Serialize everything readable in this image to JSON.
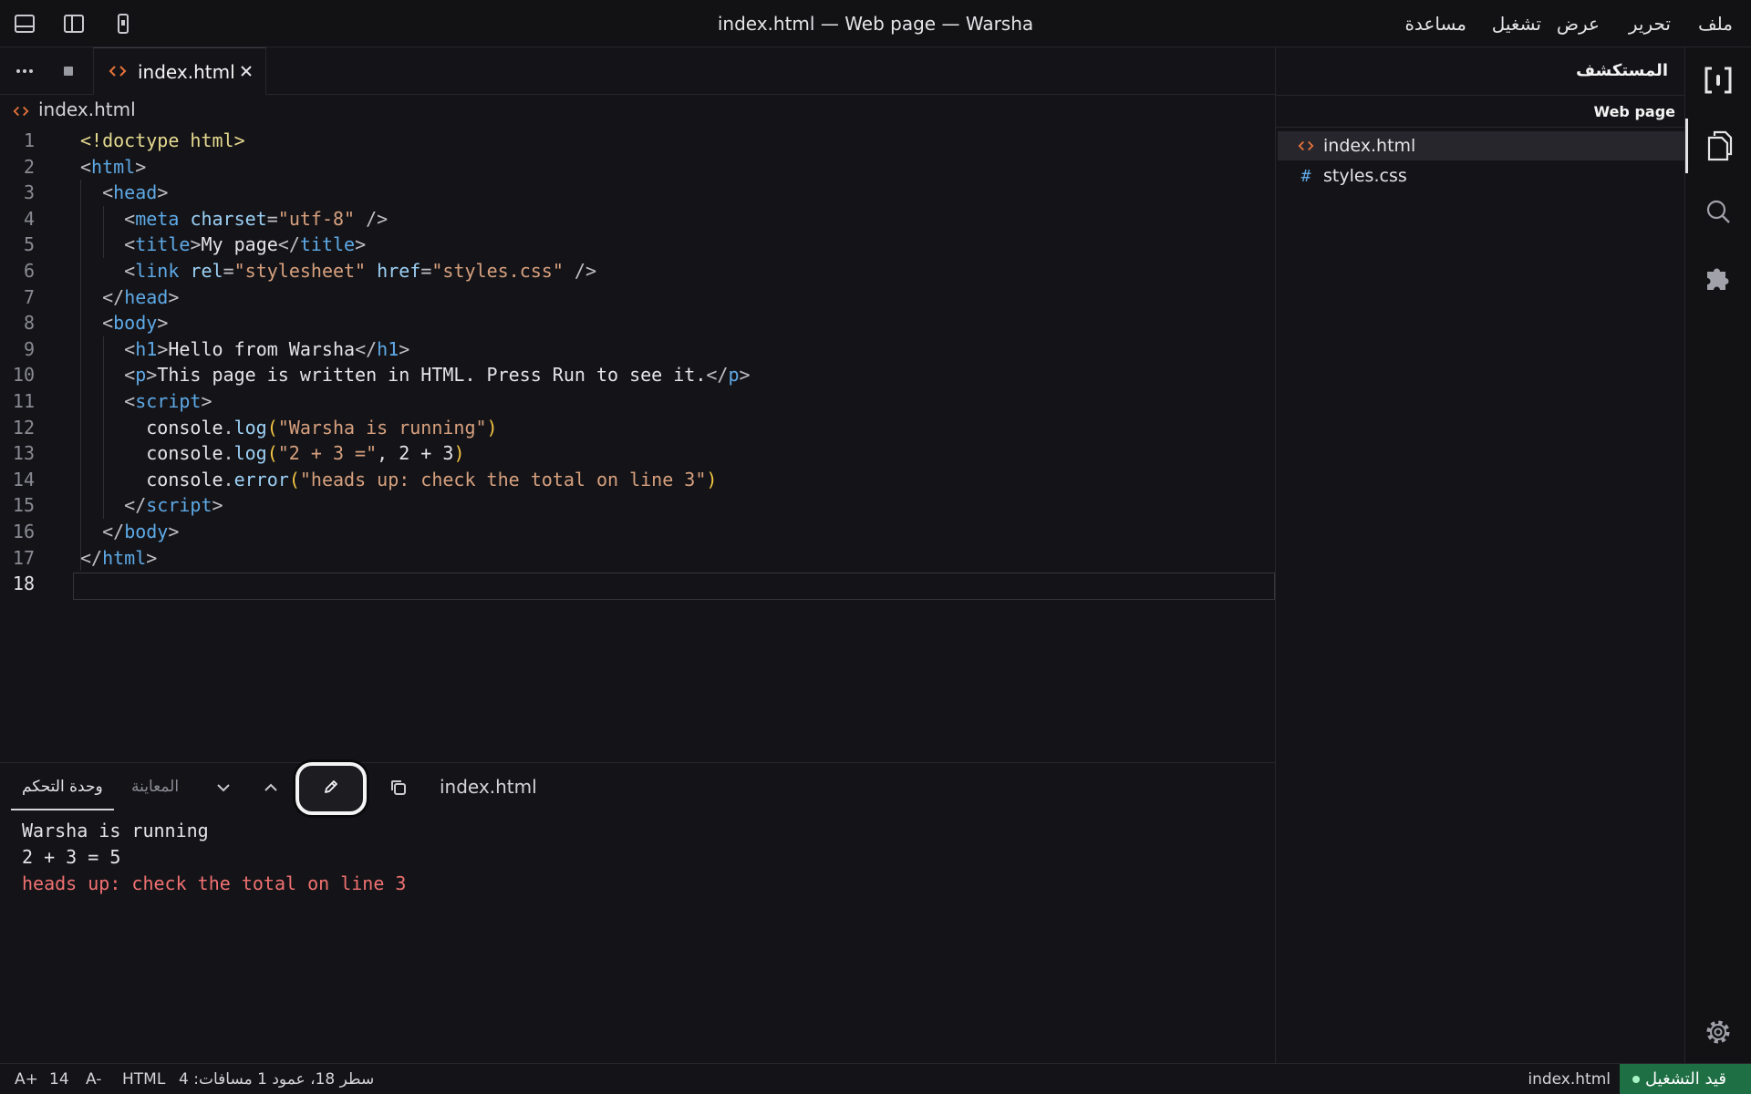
{
  "window": {
    "title": "index.html — Web page — Warsha"
  },
  "menu": [
    {
      "label": "ملف"
    },
    {
      "label": "تحرير"
    },
    {
      "label": "عرض"
    },
    {
      "label": "تشغيل"
    },
    {
      "label": "مساعدة"
    }
  ],
  "editor": {
    "tab_label": "index.html",
    "breadcrumb": "index.html",
    "active_line": 18,
    "lines": [
      {
        "n": "1"
      },
      {
        "n": "2"
      },
      {
        "n": "3"
      },
      {
        "n": "4"
      },
      {
        "n": "5"
      },
      {
        "n": "6"
      },
      {
        "n": "7"
      },
      {
        "n": "8"
      },
      {
        "n": "9"
      },
      {
        "n": "10"
      },
      {
        "n": "11"
      },
      {
        "n": "12"
      },
      {
        "n": "13"
      },
      {
        "n": "14"
      },
      {
        "n": "15"
      },
      {
        "n": "16"
      },
      {
        "n": "17"
      },
      {
        "n": "18"
      }
    ],
    "code": {
      "l1_doctype": "<!doctype html>",
      "l2_tag": "html",
      "l3_tag": "head",
      "l4_tag": "meta",
      "l4_attr": "charset",
      "l4_val": "\"utf-8\"",
      "l5_tag": "title",
      "l5_text": "My page",
      "l6_tag": "link",
      "l6_attr1": "rel",
      "l6_val1": "\"stylesheet\"",
      "l6_attr2": "href",
      "l6_val2": "\"styles.css\"",
      "l7_tag": "head",
      "l8_tag": "body",
      "l9_tag": "h1",
      "l9_text": "Hello from Warsha",
      "l10_tag": "p",
      "l10_text": "This page is written in HTML. Press Run to see it.",
      "l11_tag": "script",
      "l12_obj": "console",
      "l12_fn": "log",
      "l12_str": "\"Warsha is running\"",
      "l13_obj": "console",
      "l13_fn": "log",
      "l13_str": "\"2 + 3 =\"",
      "l13_expr": ", 2 + 3",
      "l14_obj": "console",
      "l14_fn": "error",
      "l14_str": "\"heads up: check the total on line 3\"",
      "l15_tag": "script",
      "l16_tag": "body",
      "l17_tag": "html"
    }
  },
  "panel": {
    "tab_console": "وحدة التحكم",
    "tab_preview": "المعاينة",
    "file": "index.html",
    "output": [
      {
        "text": "Warsha is running",
        "kind": "log"
      },
      {
        "text": "2 + 3 = 5",
        "kind": "log"
      },
      {
        "text": "heads up: check the total on line 3",
        "kind": "error"
      }
    ]
  },
  "explorer": {
    "title": "المستكشف",
    "folder": "Web page",
    "files": [
      {
        "label": "index.html",
        "icon": "html-icon",
        "selected": true
      },
      {
        "label": "styles.css",
        "icon": "css-icon",
        "selected": false
      }
    ]
  },
  "status": {
    "zoom_in": "A+",
    "font_size": "14",
    "zoom_out": "A-",
    "language": "HTML",
    "cursor": "سطر 18، عمود 1  مسافات: 4",
    "file": "index.html",
    "run_state": "قيد التشغيل"
  },
  "colors": {
    "accent": "#1f6f45",
    "error_text": "#f07171",
    "html_icon": "#e8733a",
    "css_icon": "#5ea9e6"
  }
}
